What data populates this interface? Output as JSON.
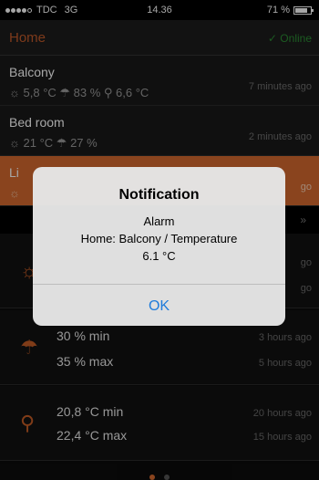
{
  "status_bar": {
    "carrier": "TDC",
    "network": "3G",
    "time": "14.36",
    "battery": "71 %",
    "battery_level": 0.71
  },
  "nav": {
    "title": "Home",
    "status": "✓ Online"
  },
  "rooms": [
    {
      "name": "Balcony",
      "readings": "☼ 5,8 °C  ☂ 83 %  ⚲ 6,6 °C",
      "time": "7 minutes ago"
    },
    {
      "name": "Bed room",
      "readings": "☼ 21 °C  ☂ 27 %",
      "time": "2 minutes ago"
    },
    {
      "name": "Li",
      "readings": "☼",
      "time": "go"
    }
  ],
  "section": {
    "chevron": "»"
  },
  "stats": [
    {
      "icon": "☼",
      "lines": [
        "",
        ""
      ],
      "times": [
        "go",
        "go"
      ]
    },
    {
      "icon": "☂",
      "lines": [
        "30 % min",
        "35 % max"
      ],
      "times": [
        "3 hours ago",
        "5 hours ago"
      ]
    },
    {
      "icon": "⚲",
      "lines": [
        "20,8 °C min",
        "22,4 °C max"
      ],
      "times": [
        "20 hours ago",
        "15 hours ago"
      ]
    }
  ],
  "alert": {
    "title": "Notification",
    "lines": [
      "Alarm",
      "Home: Balcony / Temperature",
      "6.1 °C"
    ],
    "ok_label": "OK"
  },
  "colors": {
    "accent": "#d4692e",
    "online": "#2b8c34",
    "ok_button": "#1e7bdb"
  }
}
